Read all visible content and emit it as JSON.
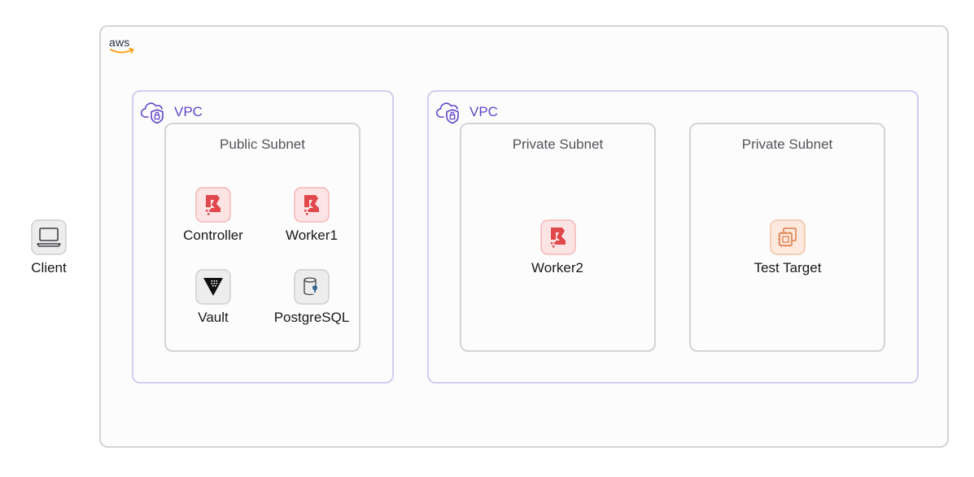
{
  "cloud": {
    "provider_logo_text": "aws"
  },
  "vpcs": [
    {
      "label": "VPC"
    },
    {
      "label": "VPC"
    }
  ],
  "subnets": [
    {
      "label": "Public Subnet"
    },
    {
      "label": "Private Subnet"
    },
    {
      "label": "Private Subnet"
    }
  ],
  "nodes": {
    "client": {
      "label": "Client",
      "icon": "laptop-icon"
    },
    "controller": {
      "label": "Controller",
      "icon": "boundary-icon"
    },
    "worker1": {
      "label": "Worker1",
      "icon": "boundary-icon"
    },
    "vault": {
      "label": "Vault",
      "icon": "vault-icon"
    },
    "postgresql": {
      "label": "PostgreSQL",
      "icon": "database-icon"
    },
    "worker2": {
      "label": "Worker2",
      "icon": "boundary-icon"
    },
    "test_target": {
      "label": "Test Target",
      "icon": "ec2-instance-icon"
    }
  },
  "colors": {
    "vpc_accent": "#6245c7",
    "boundary_red": "#e0484c",
    "ec2_orange": "#e07b46",
    "border_gray": "#d4d4d8"
  }
}
